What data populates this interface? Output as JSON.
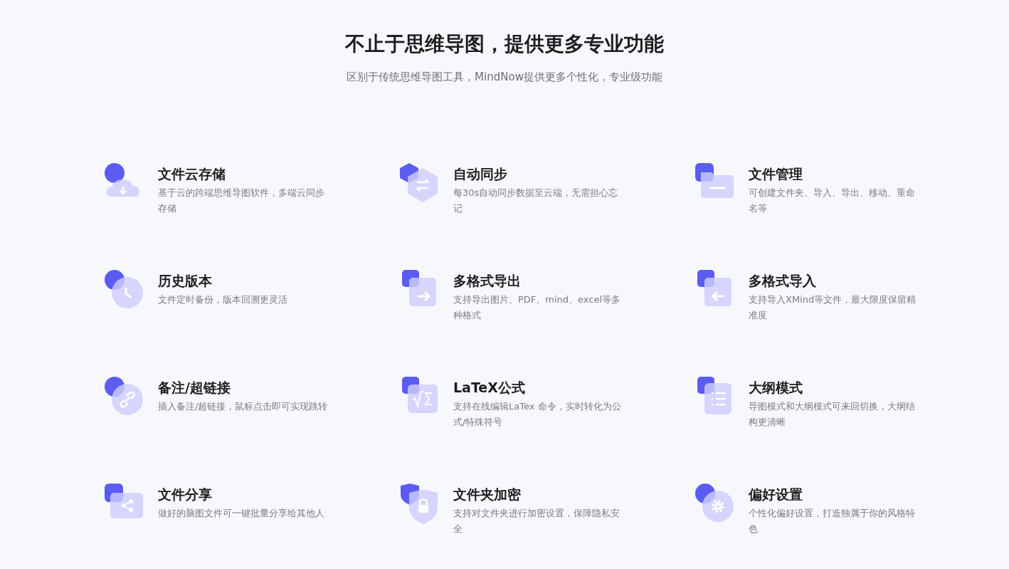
{
  "header": {
    "title": "不止于思维导图，提供更多专业功能",
    "subtitle": "区别于传统思维导图工具，MindNow提供更多个性化，专业级功能"
  },
  "features": [
    {
      "title": "文件云存储",
      "description": "基于云的跨端思维导图软件，多端云同步存储"
    },
    {
      "title": "自动同步",
      "description": "每30s自动同步数据至云端，无需担心忘记"
    },
    {
      "title": "文件管理",
      "description": "可创建文件夹、导入、导出、移动、重命名等"
    },
    {
      "title": "历史版本",
      "description": "文件定时备份，版本回溯更灵活"
    },
    {
      "title": "多格式导出",
      "description": "支持导出图片、PDF、mind、excel等多种格式"
    },
    {
      "title": "多格式导入",
      "description": "支持导入XMind等文件，最大限度保留精准度"
    },
    {
      "title": "备注/超链接",
      "description": "插入备注/超链接，鼠标点击即可实现跳转"
    },
    {
      "title": "LaTeX公式",
      "description": "支持在线编辑LaTex 命令，实时转化为公式/特殊符号"
    },
    {
      "title": "大纲模式",
      "description": "导图模式和大纲模式可来回切换，大纲结构更清晰"
    },
    {
      "title": "文件分享",
      "description": "做好的脑图文件可一键批量分享给其他人"
    },
    {
      "title": "文件夹加密",
      "description": "支持对文件夹进行加密设置，保障隐私安全"
    },
    {
      "title": "偏好设置",
      "description": "个性化偏好设置，打造独属于你的风格特色"
    }
  ]
}
